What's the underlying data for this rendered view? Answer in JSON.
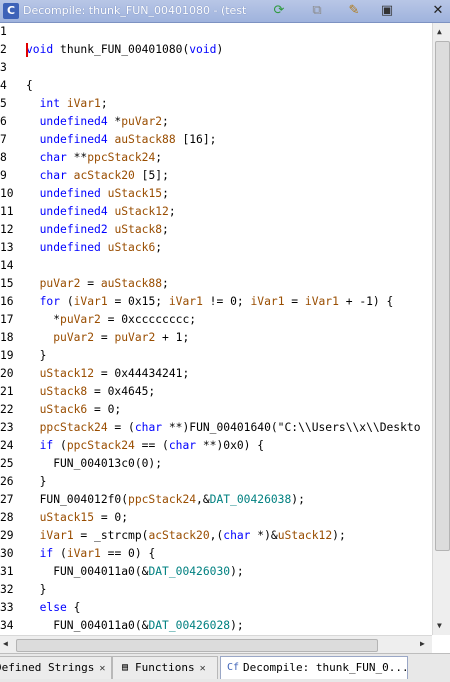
{
  "window": {
    "title": "Decompile: thunk_FUN_00401080 -  (test",
    "icon": "decompile-icon"
  },
  "toolbar": {
    "buttons": [
      {
        "name": "refresh-icon",
        "glyph": "⟳",
        "color": "#2e9a3e"
      },
      {
        "name": "copy-icon",
        "glyph": "⧉",
        "color": "#8a8a8a"
      },
      {
        "name": "edit-icon",
        "glyph": "✎",
        "color": "#b07a1a"
      },
      {
        "name": "snapshot-icon",
        "glyph": "▣",
        "color": "#333333"
      },
      {
        "name": "close-icon",
        "glyph": "✕",
        "color": "#222222"
      }
    ]
  },
  "code": {
    "lines": [
      {
        "n": "1",
        "html": ""
      },
      {
        "n": "2",
        "html": "<span class='ty'>void</span> thunk_FUN_00401080(<span class='ty'>void</span>)"
      },
      {
        "n": "3",
        "html": ""
      },
      {
        "n": "4",
        "html": "{"
      },
      {
        "n": "5",
        "html": "  <span class='ty'>int</span> <span class='var'>iVar1</span>;"
      },
      {
        "n": "6",
        "html": "  <span class='ty'>undefined4</span> *<span class='var'>puVar2</span>;"
      },
      {
        "n": "7",
        "html": "  <span class='ty'>undefined4</span> <span class='var'>auStack88</span> [16];"
      },
      {
        "n": "8",
        "html": "  <span class='ty'>char</span> **<span class='var'>ppcStack24</span>;"
      },
      {
        "n": "9",
        "html": "  <span class='ty'>char</span> <span class='var'>acStack20</span> [5];"
      },
      {
        "n": "10",
        "html": "  <span class='ty'>undefined</span> <span class='var'>uStack15</span>;"
      },
      {
        "n": "11",
        "html": "  <span class='ty'>undefined4</span> <span class='var'>uStack12</span>;"
      },
      {
        "n": "12",
        "html": "  <span class='ty'>undefined2</span> <span class='var'>uStack8</span>;"
      },
      {
        "n": "13",
        "html": "  <span class='ty'>undefined</span> <span class='var'>uStack6</span>;"
      },
      {
        "n": "14",
        "html": ""
      },
      {
        "n": "15",
        "html": "  <span class='var'>puVar2</span> = <span class='var'>auStack88</span>;"
      },
      {
        "n": "16",
        "html": "  <span class='kw'>for</span> (<span class='var'>iVar1</span> = 0x15; <span class='var'>iVar1</span> != 0; <span class='var'>iVar1</span> = <span class='var'>iVar1</span> + -1) {"
      },
      {
        "n": "17",
        "html": "    *<span class='var'>puVar2</span> = 0xcccccccc;"
      },
      {
        "n": "18",
        "html": "    <span class='var'>puVar2</span> = <span class='var'>puVar2</span> + 1;"
      },
      {
        "n": "19",
        "html": "  }"
      },
      {
        "n": "20",
        "html": "  <span class='var'>uStack12</span> = 0x44434241;"
      },
      {
        "n": "21",
        "html": "  <span class='var'>uStack8</span> = 0x4645;"
      },
      {
        "n": "22",
        "html": "  <span class='var'>uStack6</span> = 0;"
      },
      {
        "n": "23",
        "html": "  <span class='var'>ppcStack24</span> = (<span class='ty'>char</span> **)FUN_00401640(\"C:\\\\Users\\\\x\\\\Deskto"
      },
      {
        "n": "24",
        "html": "  <span class='kw'>if</span> (<span class='var'>ppcStack24</span> == (<span class='ty'>char</span> **)0x0) {"
      },
      {
        "n": "25",
        "html": "    FUN_004013c0(0);"
      },
      {
        "n": "26",
        "html": "  }"
      },
      {
        "n": "27",
        "html": "  FUN_004012f0(<span class='var'>ppcStack24</span>,&amp;<span class='glob'>DAT_00426038</span>);"
      },
      {
        "n": "28",
        "html": "  <span class='var'>uStack15</span> = 0;"
      },
      {
        "n": "29",
        "html": "  <span class='var'>iVar1</span> = _strcmp(<span class='var'>acStack20</span>,(<span class='ty'>char</span> *)&amp;<span class='var'>uStack12</span>);"
      },
      {
        "n": "30",
        "html": "  <span class='kw'>if</span> (<span class='var'>iVar1</span> == 0) {"
      },
      {
        "n": "31",
        "html": "    FUN_004011a0(&amp;<span class='glob'>DAT_00426030</span>);"
      },
      {
        "n": "32",
        "html": "  }"
      },
      {
        "n": "33",
        "html": "  <span class='kw'>else</span> {"
      },
      {
        "n": "34",
        "html": "    FUN_004011a0(&amp;<span class='glob'>DAT_00426028</span>);"
      }
    ]
  },
  "tabs": [
    {
      "label": "Defined Strings",
      "icon": "strings-icon",
      "icon_glyph": "",
      "active": false
    },
    {
      "label": "Functions",
      "icon": "functions-icon",
      "icon_glyph": "▤",
      "active": false
    },
    {
      "label": "Decompile: thunk_FUN_0...",
      "icon": "decompile-icon",
      "icon_glyph": "Cf",
      "active": true
    }
  ],
  "tab_close_glyph": "✕"
}
